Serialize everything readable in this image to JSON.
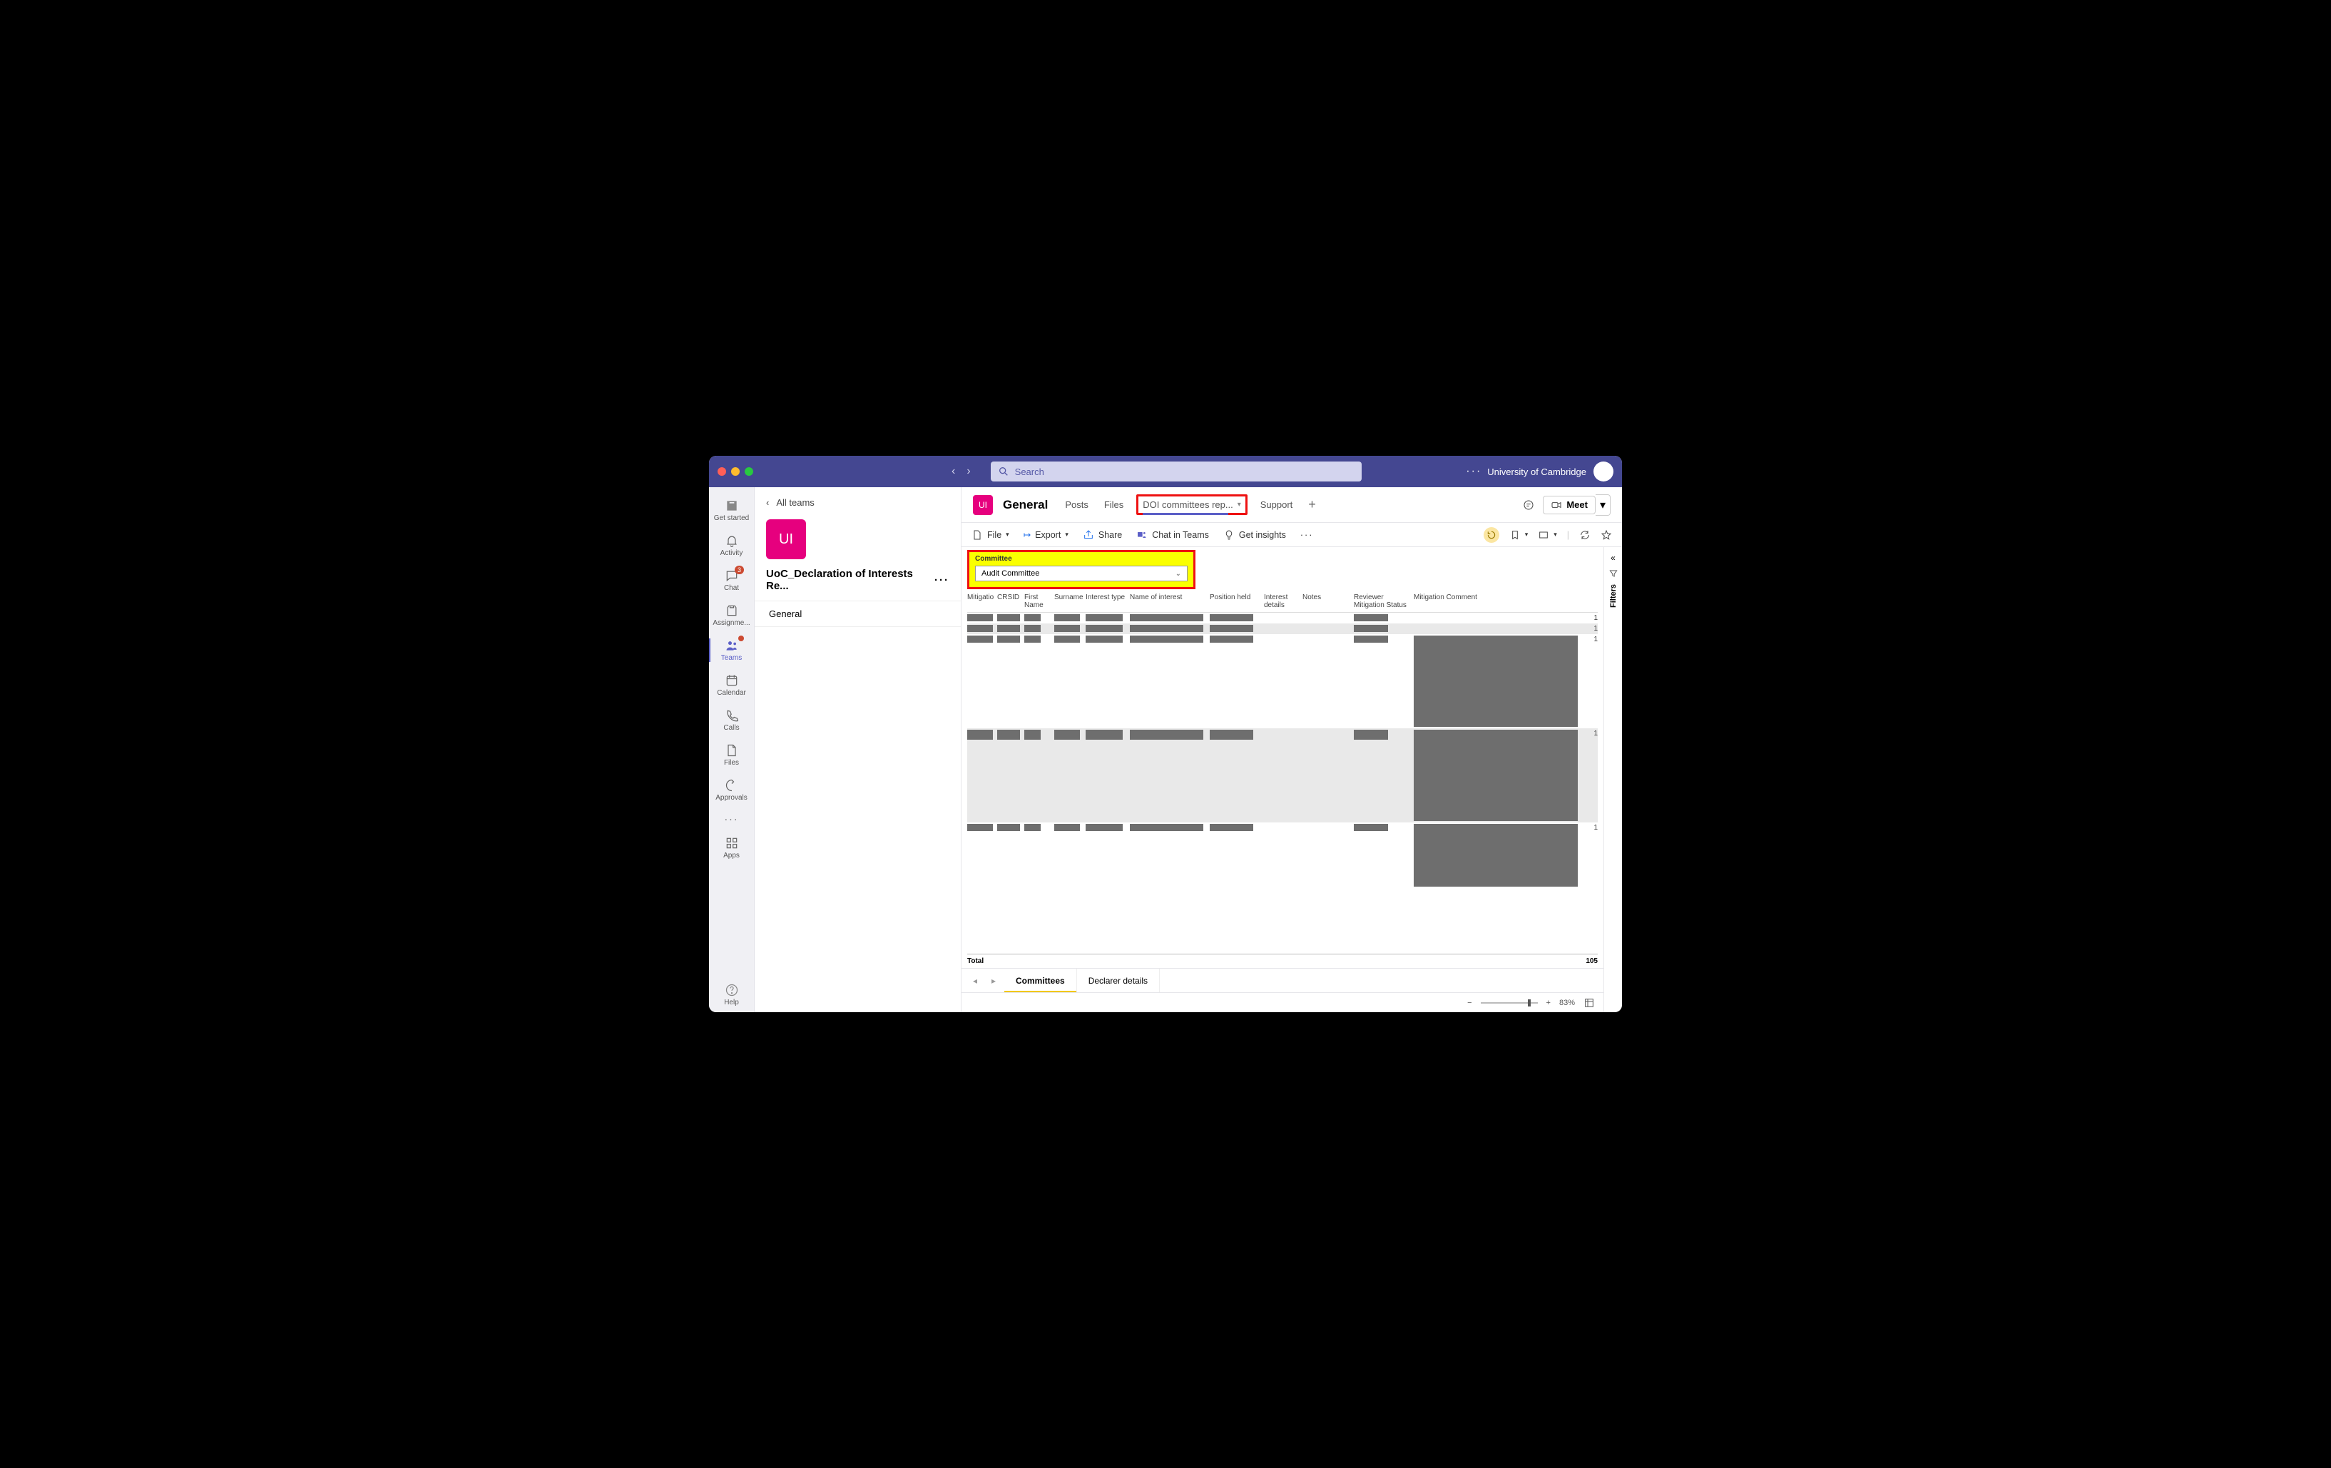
{
  "titlebar": {
    "search_placeholder": "Search",
    "org_name": "University of Cambridge"
  },
  "rail": {
    "items": [
      {
        "label": "Get started",
        "icon": "getstarted"
      },
      {
        "label": "Activity",
        "icon": "bell"
      },
      {
        "label": "Chat",
        "icon": "chat",
        "badge": "3"
      },
      {
        "label": "Assignme...",
        "icon": "assign"
      },
      {
        "label": "Teams",
        "icon": "teams",
        "active": true,
        "badge": "●"
      },
      {
        "label": "Calendar",
        "icon": "calendar"
      },
      {
        "label": "Calls",
        "icon": "calls"
      },
      {
        "label": "Files",
        "icon": "files"
      },
      {
        "label": "Approvals",
        "icon": "approvals"
      }
    ],
    "more_label": "",
    "apps_label": "Apps",
    "help_label": "Help"
  },
  "leftpane": {
    "back_label": "All teams",
    "team_initials": "UI",
    "team_name": "UoC_Declaration of Interests Re...",
    "channels": [
      "General"
    ]
  },
  "tabs": {
    "team_chip": "UI",
    "channel": "General",
    "items": [
      "Posts",
      "Files"
    ],
    "highlighted": "DOI committees rep...",
    "after": [
      "Support"
    ],
    "meet": "Meet"
  },
  "pbi_toolbar": {
    "file": "File",
    "export": "Export",
    "share": "Share",
    "chat": "Chat in Teams",
    "insights": "Get insights"
  },
  "filter": {
    "label": "Committee",
    "value": "Audit Committee"
  },
  "table": {
    "headers": {
      "mitigation": "Mitigation",
      "crsid": "CRSID",
      "first": "First Name",
      "surname": "Surname",
      "itype": "Interest type",
      "iname": "Name of interest",
      "pos": "Position held",
      "idet": "Interest details",
      "notes": "Notes",
      "rms": "Reviewer Mitigation Status",
      "mc": "Mitigation Comment"
    },
    "rows": [
      {
        "alt": false,
        "h": 10,
        "mcH": 0,
        "count": "1"
      },
      {
        "alt": true,
        "h": 10,
        "mcH": 0,
        "count": "1"
      },
      {
        "alt": false,
        "h": 10,
        "mcH": 128,
        "count": "1"
      },
      {
        "alt": true,
        "h": 14,
        "mcH": 128,
        "count": "1"
      },
      {
        "alt": false,
        "h": 10,
        "mcH": 88,
        "count": "1"
      }
    ],
    "total_label": "Total",
    "total_value": "105"
  },
  "filters_rail": {
    "label": "Filters"
  },
  "pager": {
    "pages": [
      {
        "label": "Committees",
        "active": true
      },
      {
        "label": "Declarer details",
        "active": false
      }
    ]
  },
  "status": {
    "zoom": "83%"
  }
}
